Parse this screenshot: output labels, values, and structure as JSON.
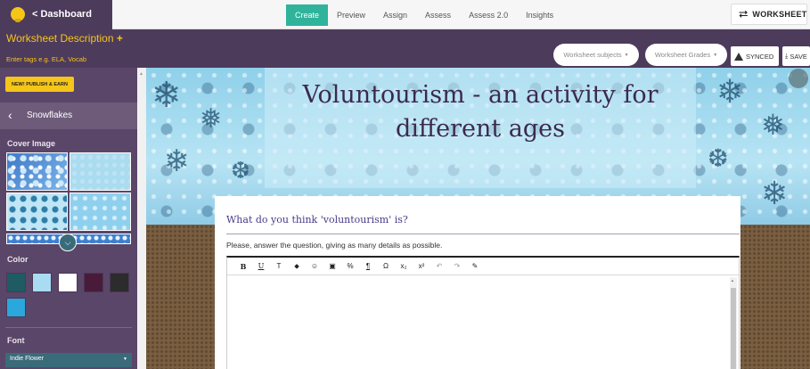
{
  "topbar": {
    "dashboard_label": "< Dashboard",
    "tabs": [
      {
        "label": "Create"
      },
      {
        "label": "Preview"
      },
      {
        "label": "Assign"
      },
      {
        "label": "Assess"
      },
      {
        "label": "Assess 2.0"
      },
      {
        "label": "Insights"
      }
    ],
    "worksheet_label": "WORKSHEET",
    "active_tab_color": "#2fb39b"
  },
  "header": {
    "description_label": "Worksheet Description",
    "description_plus": "+",
    "tags_placeholder": "Enter tags e.g. ELA, Vocab",
    "subjects_label": "Worksheet subjects",
    "grades_label": "Worksheet Grades",
    "synced_label": "SYNCED",
    "save_label": "SAVE"
  },
  "sidebar": {
    "publish_label": "NEW! PUBLISH & EARN",
    "theme_name": "Snowflakes",
    "cover_image_label": "Cover Image",
    "color_label": "Color",
    "font_label": "Font",
    "font_value": "Indie Flower",
    "swatches": [
      "#1f5b63",
      "#a9dcf3",
      "#ffffff",
      "#4a1a3a",
      "#2c2c2c",
      "#2aa7dc"
    ]
  },
  "worksheet": {
    "title_line1": "Voluntourism - an activity for",
    "title_line2": "different ages",
    "question": "What do you think 'voluntourism' is?",
    "instructions": "Please, answer the question, giving as many details as possible.",
    "toolbar": [
      "B",
      "U",
      "T",
      "⬥",
      "☺",
      "▣",
      "%",
      "¶",
      "Ω",
      "x₂",
      "x²",
      "↶",
      "↷",
      "✎"
    ]
  },
  "colors": {
    "brand_purple": "#4d3b5c",
    "sidebar_purple": "#5a4668",
    "accent_yellow": "#f5c518"
  }
}
